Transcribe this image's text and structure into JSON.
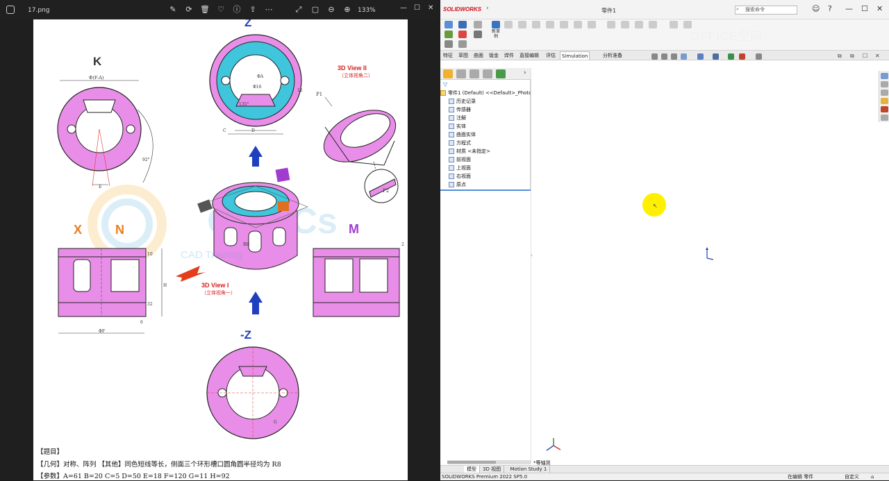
{
  "viewer": {
    "filename": "17.png",
    "zoom": "133%",
    "toolbar_icons": [
      "edit-icon",
      "rotate-icon",
      "delete-icon",
      "heart-icon",
      "info-icon",
      "share-icon",
      "more-icon",
      "expand-icon",
      "fit-icon",
      "zoom-out-icon",
      "zoom-in-icon"
    ]
  },
  "drawing": {
    "labels": {
      "top_view": "Z",
      "left_view": "K",
      "left_dim_top": "Φ(F-A)",
      "x_label": "X",
      "n_label": "N",
      "m_label": "M",
      "bottom_view": "-Z",
      "view2": "3D View II",
      "view2_cn": "（立体视角二）",
      "view1": "3D View I",
      "view1_cn": "（立体视角一）",
      "p1": "P1",
      "p2": "P2",
      "dim_a": "ΦA",
      "dim_d16": "Φ16",
      "dim_12": "12",
      "dim_135": "135°",
      "dim_c": "C",
      "dim_d": "D",
      "dim_92": "92°",
      "dim_e": "E",
      "dim_b": "B",
      "dim_h": "H",
      "dim_phif": "ΦF",
      "dim_r8": "R8",
      "dim_2": "2",
      "dim_10": "10",
      "dim_6": "6",
      "dim_32": "32",
      "dim_g": "G",
      "watermark": "CAD Training"
    },
    "problem_title": "【题目】",
    "problem_geometry": "【几何】对称、阵列 【其他】同色短线等长，侧面三个环形槽口圆角圆半径均为 R8",
    "problem_params": "【参数】A=61   B=20   C=5   D=50   E=18   F=120   G=11   H=92"
  },
  "sw": {
    "brand": "SOLIDWORKS",
    "doc_title": "零件1",
    "search_placeholder": "搜索命令",
    "ribbon_new_label": "新草例",
    "ribbon_watermark": "OFFICE空间",
    "command_tabs": [
      "特征",
      "草图",
      "曲面",
      "钣金",
      "焊件",
      "直接编辑",
      "评估",
      "Simulation",
      "分析准备"
    ],
    "active_tab": "Simulation",
    "tree": {
      "root": "零件1 (Default) <<Default>_PhotoV",
      "items": [
        "历史记录",
        "传感器",
        "注解",
        "实体",
        "曲面实体",
        "方程式",
        "材质 <未指定>",
        "前视面",
        "上视面",
        "右视面",
        "原点"
      ]
    },
    "view_label": "*等轴测",
    "model_tabs": [
      "模型",
      "3D 视图",
      "Motion Study 1"
    ],
    "active_model_tab": "模型",
    "status_left": "SOLIDWORKS Premium 2022 SP5.0",
    "status_edit": "在编辑 零件",
    "status_custom": "自定义"
  }
}
